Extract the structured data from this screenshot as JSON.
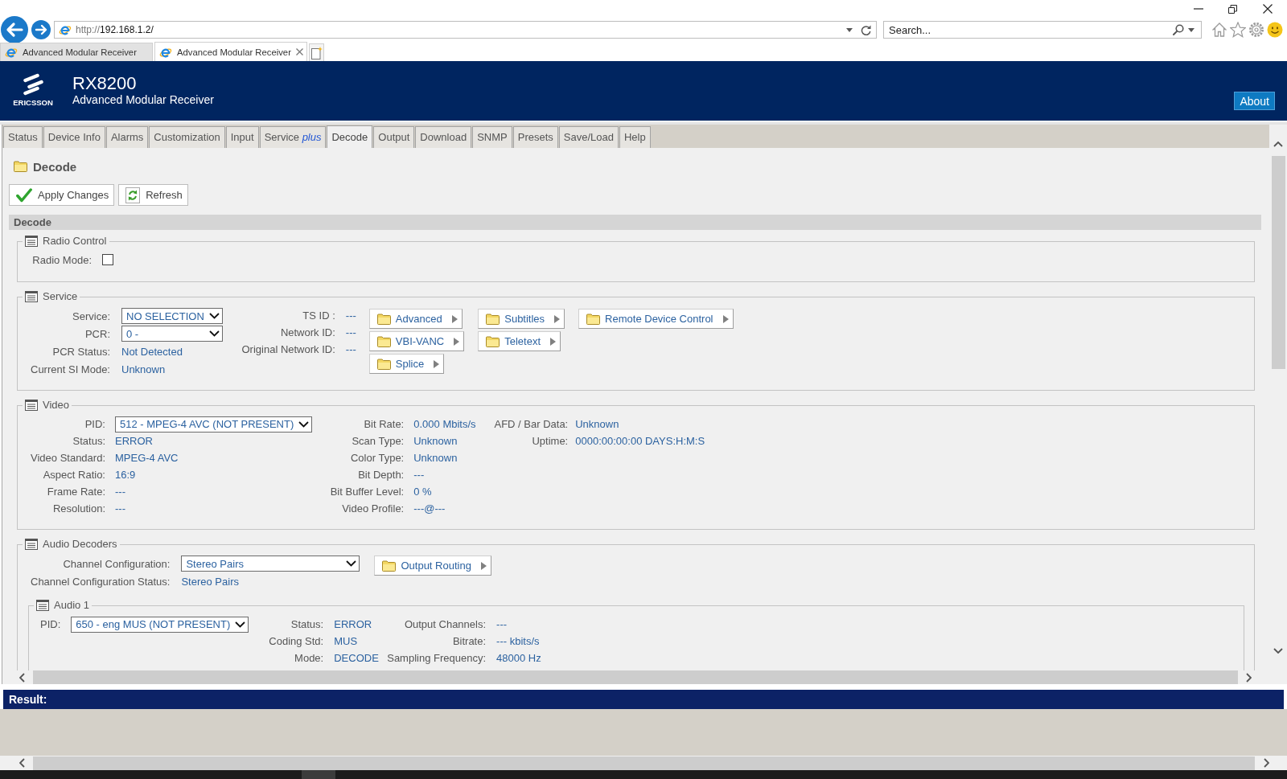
{
  "browser": {
    "address": {
      "scheme": "http://",
      "host": "192.168.1.2/"
    },
    "search": {
      "placeholder": "Search..."
    },
    "tabs": [
      {
        "label": "Advanced Modular Receiver",
        "selected": false
      },
      {
        "label": "Advanced Modular Receiver",
        "selected": true
      }
    ]
  },
  "header": {
    "logo_text": "ERICSSON",
    "model": "RX8200",
    "subtitle": "Advanced Modular Receiver",
    "about_button": "About"
  },
  "nav_tabs": [
    {
      "label": "Status",
      "selected": false
    },
    {
      "label": "Device Info",
      "selected": false
    },
    {
      "label": "Alarms",
      "selected": false
    },
    {
      "label": "Customization",
      "selected": false
    },
    {
      "label": "Input",
      "selected": false
    },
    {
      "label": "Service *plus*",
      "selected": false
    },
    {
      "label": "Decode",
      "selected": true
    },
    {
      "label": "Output",
      "selected": false
    },
    {
      "label": "Download",
      "selected": false
    },
    {
      "label": "SNMP",
      "selected": false
    },
    {
      "label": "Presets",
      "selected": false
    },
    {
      "label": "Save/Load",
      "selected": false
    },
    {
      "label": "Help",
      "selected": false
    }
  ],
  "page": {
    "title": "Decode",
    "buttons": [
      {
        "kind": "apply",
        "label": "Apply Changes"
      },
      {
        "kind": "refresh",
        "label": "Refresh"
      }
    ],
    "section_title": "Decode"
  },
  "sections": [
    {
      "legend": "Radio Control",
      "columns": [
        {
          "fields": [
            {
              "kind": "checkbox",
              "label": "Radio Mode:",
              "checked": false
            }
          ]
        }
      ]
    },
    {
      "legend": "Service",
      "columns": [
        {
          "fields": [
            {
              "kind": "select",
              "label": "Service:",
              "value": "NO SELECTION"
            },
            {
              "kind": "select",
              "label": "PCR:",
              "value": "0 -"
            },
            {
              "kind": "text",
              "label": "PCR Status:",
              "value": "Not Detected"
            },
            {
              "kind": "text",
              "label": "Current SI Mode:",
              "value": "Unknown"
            }
          ]
        },
        {
          "fields": [
            {
              "kind": "text",
              "label": "TS ID :",
              "value": "---"
            },
            {
              "kind": "text",
              "label": "Network ID:",
              "value": "---"
            },
            {
              "kind": "text",
              "label": "Original Network ID:",
              "value": "---"
            }
          ]
        }
      ],
      "link_columns": [
        [
          "Advanced",
          "VBI-VANC",
          "Splice"
        ],
        [
          "Subtitles",
          "Teletext"
        ],
        [
          "Remote Device Control"
        ]
      ]
    },
    {
      "legend": "Video",
      "columns": [
        {
          "fields": [
            {
              "kind": "select",
              "label": "PID:",
              "value": "512 - MPEG-4 AVC (NOT PRESENT)"
            },
            {
              "kind": "text",
              "label": "Status:",
              "value": "ERROR"
            },
            {
              "kind": "text",
              "label": "Video Standard:",
              "value": "MPEG-4 AVC"
            },
            {
              "kind": "text",
              "label": "Aspect Ratio:",
              "value": "16:9"
            },
            {
              "kind": "text",
              "label": "Frame Rate:",
              "value": "---"
            },
            {
              "kind": "text",
              "label": "Resolution:",
              "value": "---"
            }
          ]
        },
        {
          "fields": [
            {
              "kind": "text",
              "label": "Bit Rate:",
              "value": "0.000 Mbits/s"
            },
            {
              "kind": "text",
              "label": "Scan Type:",
              "value": "Unknown"
            },
            {
              "kind": "text",
              "label": "Color Type:",
              "value": "Unknown"
            },
            {
              "kind": "text",
              "label": "Bit Depth:",
              "value": "---"
            },
            {
              "kind": "text",
              "label": "Bit Buffer Level:",
              "value": "0 %"
            },
            {
              "kind": "text",
              "label": "Video Profile:",
              "value": "---@---"
            }
          ]
        },
        {
          "fields": [
            {
              "kind": "text",
              "label": "AFD / Bar Data:",
              "value": "Unknown"
            },
            {
              "kind": "text",
              "label": "Uptime:",
              "value": "0000:00:00:00 DAYS:H:M:S"
            }
          ]
        }
      ]
    },
    {
      "legend": "Audio Decoders",
      "columns": [
        {
          "fields": [
            {
              "kind": "select",
              "label": "Channel Configuration:",
              "value": "Stereo Pairs"
            },
            {
              "kind": "text",
              "label": "Channel Configuration Status:",
              "value": "Stereo Pairs"
            }
          ]
        }
      ],
      "link_columns": [
        [
          "Output Routing"
        ]
      ],
      "subsections": [
        {
          "legend": "Audio 1",
          "columns": [
            {
              "fields": [
                {
                  "kind": "select",
                  "label": "PID:",
                  "value": "650 - eng MUS (NOT PRESENT)"
                }
              ]
            },
            {
              "fields": [
                {
                  "kind": "text",
                  "label": "Status:",
                  "value": "ERROR"
                },
                {
                  "kind": "text",
                  "label": "Coding Std:",
                  "value": "MUS"
                },
                {
                  "kind": "text",
                  "label": "Mode:",
                  "value": "DECODE"
                }
              ]
            },
            {
              "fields": [
                {
                  "kind": "text",
                  "label": "Output Channels:",
                  "value": "---"
                },
                {
                  "kind": "text",
                  "label": "Bitrate:",
                  "value": "--- kbits/s"
                },
                {
                  "kind": "text",
                  "label": "Sampling Frequency:",
                  "value": "48000 Hz"
                }
              ]
            }
          ]
        }
      ]
    }
  ],
  "result": {
    "label": "Result:"
  }
}
